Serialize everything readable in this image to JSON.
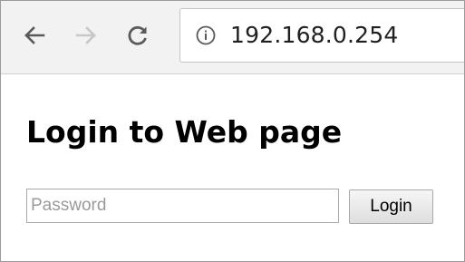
{
  "browser": {
    "url": "192.168.0.254",
    "icons": {
      "back": "arrow-left-icon",
      "forward": "arrow-right-icon",
      "reload": "reload-icon",
      "site_info": "info-icon"
    },
    "colors": {
      "toolbar_bg": "#f2f2f2",
      "icon_active": "#5a5a5a",
      "icon_disabled": "#c8c8c8"
    }
  },
  "page": {
    "title": "Login to Web page",
    "password_placeholder": "Password",
    "password_value": "",
    "login_label": "Login"
  }
}
